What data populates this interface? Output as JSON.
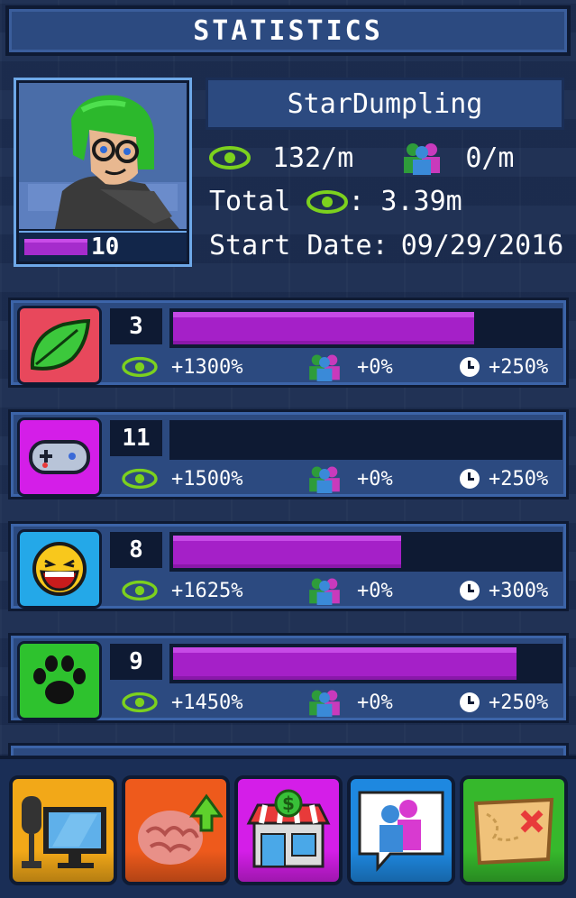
{
  "header": {
    "title": "STATISTICS"
  },
  "profile": {
    "name": "StarDumpling",
    "level": "10",
    "level_progress": 0.4,
    "views_rate": "132/m",
    "subs_rate": "0/m",
    "total_label": "Total",
    "total_value": ": 3.39m",
    "start_date_label": "Start Date:",
    "start_date": "09/29/2016"
  },
  "categories": [
    {
      "icon": "leaf-icon",
      "color": "#e8485c",
      "level": "3",
      "progress": 0.78,
      "views_bonus": "+1300%",
      "subs_bonus": "+0%",
      "time_bonus": "+250%"
    },
    {
      "icon": "gamepad-icon",
      "color": "#d41ee8",
      "level": "11",
      "progress": 0.0,
      "views_bonus": "+1500%",
      "subs_bonus": "+0%",
      "time_bonus": "+250%"
    },
    {
      "icon": "laughing-face-icon",
      "color": "#24a8e8",
      "level": "8",
      "progress": 0.59,
      "views_bonus": "+1625%",
      "subs_bonus": "+0%",
      "time_bonus": "+300%"
    },
    {
      "icon": "paw-icon",
      "color": "#2ec22e",
      "level": "9",
      "progress": 0.89,
      "views_bonus": "+1450%",
      "subs_bonus": "+0%",
      "time_bonus": "+250%"
    }
  ],
  "nav": [
    {
      "icon": "computer-icon",
      "color": "#f2a818"
    },
    {
      "icon": "brain-upgrade-icon",
      "color": "#ee5a1c"
    },
    {
      "icon": "shop-icon",
      "color": "#d41ee8"
    },
    {
      "icon": "social-chat-icon",
      "color": "#1e88e0"
    },
    {
      "icon": "map-icon",
      "color": "#36b82c"
    }
  ]
}
